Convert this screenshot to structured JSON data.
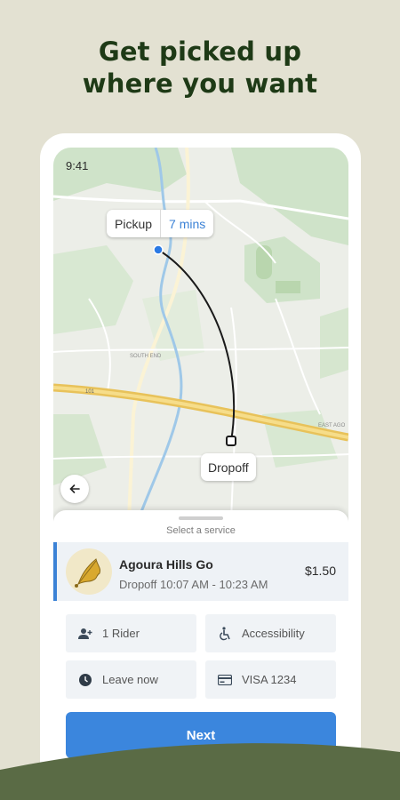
{
  "headline": {
    "line1": "Get picked up",
    "line2": "where you want"
  },
  "status_bar": {
    "time": "9:41"
  },
  "map": {
    "pickup_label": "Pickup",
    "pickup_eta": "7 mins",
    "dropoff_label": "Dropoff",
    "place_labels": [
      "SOUTH END",
      "EAST AGO",
      "101"
    ]
  },
  "sheet": {
    "title": "Select a service",
    "service": {
      "name": "Agoura Hills Go",
      "dropoff_window": "Dropoff 10:07 AM - 10:23 AM",
      "price": "$1.50"
    },
    "options": {
      "riders": "1 Rider",
      "accessibility": "Accessibility",
      "leave": "Leave now",
      "payment": "VISA 1234"
    },
    "next_label": "Next"
  },
  "colors": {
    "background": "#e3e1d2",
    "headline": "#1e3a16",
    "accent_blue": "#3b86dd",
    "hill": "#5a6b45"
  },
  "icons": [
    "back-arrow-icon",
    "rider-icon",
    "accessibility-icon",
    "clock-icon",
    "credit-card-icon",
    "oak-leaf-logo"
  ]
}
